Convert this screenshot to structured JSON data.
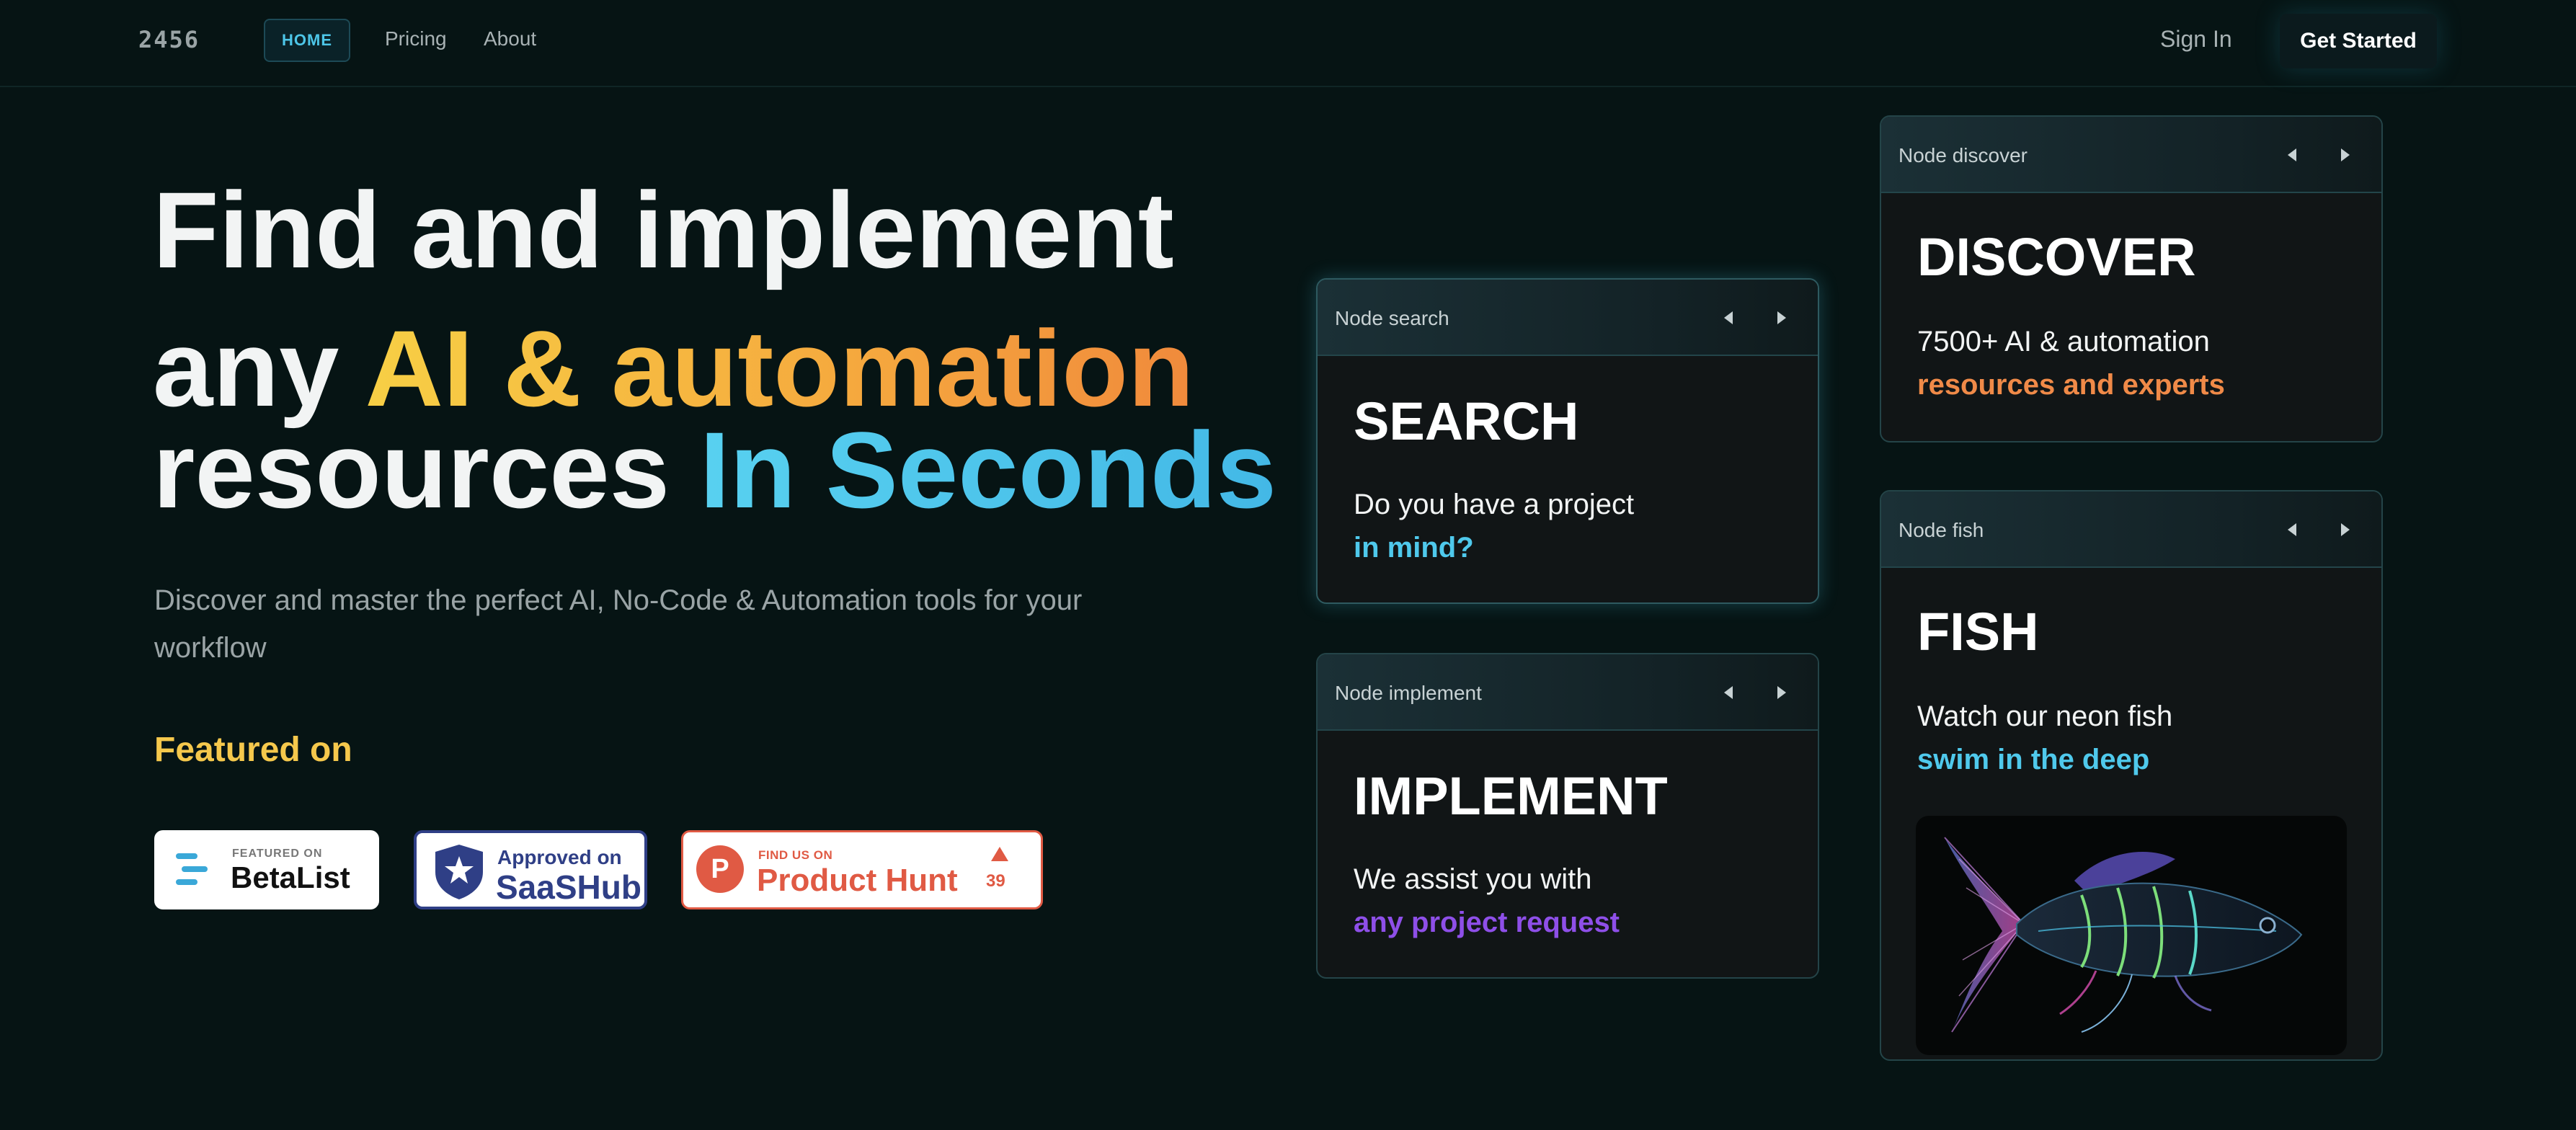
{
  "nav": {
    "logo": "2456",
    "home": "HOME",
    "pricing": "Pricing",
    "about": "About",
    "sign_in": "Sign In",
    "get_started": "Get Started"
  },
  "hero": {
    "line1": "Find and implement",
    "line2_a": "any ",
    "line2_b": "AI & automation",
    "line3_a": "resources ",
    "line3_b": "In Seconds",
    "subtitle": "Discover and master the perfect AI, No-Code & Automation tools for your workflow",
    "featured_on": "Featured on"
  },
  "badges": {
    "betalist": {
      "small": "FEATURED ON",
      "big": "BetaList"
    },
    "saashub": {
      "small": "Approved on",
      "big": "SaaSHub"
    },
    "producthunt": {
      "icon_letter": "P",
      "small": "FIND US ON",
      "big": "Product Hunt",
      "upvotes": "39"
    }
  },
  "nodes": {
    "search": {
      "label": "Node search",
      "title": "SEARCH",
      "text1": "Do you have a project",
      "text2": "in mind?",
      "accent": "#4fc9ec"
    },
    "implement": {
      "label": "Node implement",
      "title": "IMPLEMENT",
      "text1": "We assist you with",
      "text2": "any project request",
      "accent": "#8e4fe8"
    },
    "discover": {
      "label": "Node discover",
      "title": "DISCOVER",
      "text1": "7500+ AI & automation",
      "text2": "resources and experts",
      "accent": "#f08a48"
    },
    "fish": {
      "label": "Node fish",
      "title": "FISH",
      "text1": "Watch our neon fish",
      "text2": "swim in the deep",
      "accent": "#4fc9ec"
    }
  },
  "colors": {
    "background": "#061414",
    "yellow": "#f7cf45",
    "orange": "#f08a3c",
    "blue": "#43b8e6"
  }
}
